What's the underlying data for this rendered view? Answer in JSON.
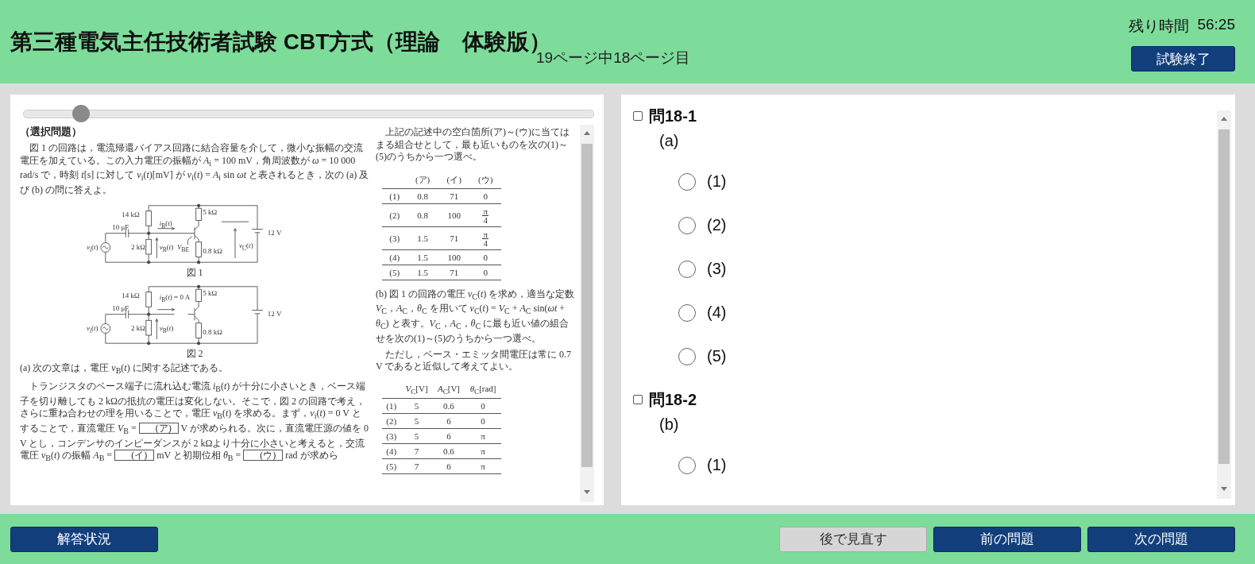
{
  "header": {
    "title": "第三種電気主任技術者試験 CBT方式（理論　体験版）",
    "page_indicator": "19ページ中18ページ目",
    "timer": {
      "label": "残り時間",
      "value": "56:25"
    },
    "end_button": "試験終了"
  },
  "document": {
    "slider": {
      "level": 0.1
    },
    "columns": [
      {
        "blocks": [
          {
            "kind": "heading",
            "text": "（選択問題）"
          },
          {
            "kind": "paragraph",
            "indent": true,
            "parts": [
              "図 1 の回路は，電流帰還バイアス回路に結合容量を介して，微小な振幅の交流電圧を加えている。この入力電圧の振幅が *A*$_{i}$ = 100 mV，角周波数が *ω* = 10 000 rad/s で，時刻 *t*[s] に対して *v*$_{i}$(*t*)[mV] が *v*$_{i}$(*t*) = *A*$_{i}$ sin *ωt* と表されるとき，次の (a) 及び (b) の問に答えよ。"
            ]
          },
          {
            "kind": "figure",
            "caption": "図 1",
            "labels": [
              "*v*$_{i}$(*t*)",
              "10 μF",
              "14 kΩ",
              "2 kΩ",
              "*i*$_{B}$(*t*)",
              "*v*$_{B}$(*t*)",
              "*V*$_{BE}$",
              "5 kΩ",
              "0.8 kΩ",
              "*v*$_{C}$(*t*)",
              "12 V"
            ]
          },
          {
            "kind": "figure",
            "caption": "図 2",
            "labels": [
              "*v*$_{i}$(*t*)",
              "10 μF",
              "14 kΩ",
              "2 kΩ",
              "*i*$_{B}$(*t*) = 0 A",
              "*v*$_{B}$(*t*)",
              "5 kΩ",
              "0.8 kΩ",
              "12 V"
            ]
          },
          {
            "kind": "paragraph",
            "indent": false,
            "parts": [
              "(a) 次の文章は，電圧 *v*$_{B}$(*t*) に関する記述である。"
            ]
          },
          {
            "kind": "paragraph",
            "indent": true,
            "parts": [
              "トランジスタのベース端子に流れ込む電流 *i*$_{B}$(*t*) が十分に小さいとき，ベース端子を切り離しても 2 kΩの抵抗の電圧は変化しない。そこで，図 2 の回路で考え，さらに重ね合わせの理を用いることで，電圧 *v*$_{B}$(*t*) を求める。まず，*v*$_{i}$(*t*) = 0 V とすることで，直流電圧 *V*$_{B}$ = ",
              {
                "blank": "(ア)"
              },
              " V が求められる。次に，直流電圧源の値を 0 V とし，コンデンサのインピーダンスが 2 kΩより十分に小さいと考えると，交流電圧 *v*$_{B}$(*t*) の振幅 *A*$_{B}$ = ",
              {
                "blank": "(イ)"
              },
              " mV と初期位相 *θ*$_{B}$ = ",
              {
                "blank": "(ウ)"
              },
              " rad が求めら"
            ]
          }
        ]
      },
      {
        "blocks": [
          {
            "kind": "paragraph",
            "indent": true,
            "parts": [
              "上記の記述中の空白箇所(ア)～(ウ)に当てはまる組合せとして，最も近いものを次の(1)～(5)のうちから一つ選べ。"
            ]
          },
          {
            "kind": "table",
            "header": [
              "(ア)",
              "(イ)",
              "(ウ)"
            ],
            "rows": [
              [
                "(1)",
                "0.8",
                "71",
                "0"
              ],
              [
                "(2)",
                "0.8",
                "100",
                {
                  "numerator": "π",
                  "denominator": "4"
                }
              ],
              [
                "(3)",
                "1.5",
                "71",
                {
                  "numerator": "π",
                  "denominator": "4"
                }
              ],
              [
                "(4)",
                "1.5",
                "100",
                "0"
              ],
              [
                "(5)",
                "1.5",
                "71",
                "0"
              ]
            ]
          },
          {
            "kind": "paragraph",
            "indent": false,
            "parts": [
              "(b) 図 1 の回路の電圧 *v*$_{C}$(*t*) を求め，適当な定数 *V*$_{C}$，*A*$_{C}$，*θ*$_{C}$ を用いて *v*$_{C}$(*t*) = *V*$_{C}$ + *A*$_{C}$ sin(*ωt* + *θ*$_{C}$) と表す。*V*$_{C}$，*A*$_{C}$，*θ*$_{C}$ に最も近い値の組合せを次の(1)～(5)のうちから一つ選べ。"
            ]
          },
          {
            "kind": "paragraph",
            "indent": true,
            "parts": [
              "ただし，ベース・エミッタ間電圧は常に 0.7 V であると近似して考えてよい。"
            ]
          },
          {
            "kind": "table",
            "header": [
              "*V*$_{C}$[V]",
              "*A*$_{C}$[V]",
              "*θ*$_{C}$[rad]"
            ],
            "rows": [
              [
                "(1)",
                "5",
                "0.6",
                "0"
              ],
              [
                "(2)",
                "5",
                "6",
                "0"
              ],
              [
                "(3)",
                "5",
                "6",
                "π"
              ],
              [
                "(4)",
                "7",
                "0.6",
                "π"
              ],
              [
                "(5)",
                "7",
                "6",
                "π"
              ]
            ]
          }
        ]
      }
    ]
  },
  "questions": [
    {
      "label": "問18-1",
      "checked": false,
      "part": "(a)",
      "options": [
        {
          "label": "(1)",
          "selected": false
        },
        {
          "label": "(2)",
          "selected": false
        },
        {
          "label": "(3)",
          "selected": false
        },
        {
          "label": "(4)",
          "selected": false
        },
        {
          "label": "(5)",
          "selected": false
        }
      ]
    },
    {
      "label": "問18-2",
      "checked": false,
      "part": "(b)",
      "options": [
        {
          "label": "(1)",
          "selected": false
        }
      ]
    }
  ],
  "footer": {
    "left_buttons": [
      {
        "label": "解答状況",
        "kind": "primary"
      }
    ],
    "right_buttons": [
      {
        "label": "後で見直す",
        "kind": "secondary"
      },
      {
        "label": "前の問題",
        "kind": "primary"
      },
      {
        "label": "次の問題",
        "kind": "primary"
      }
    ]
  }
}
